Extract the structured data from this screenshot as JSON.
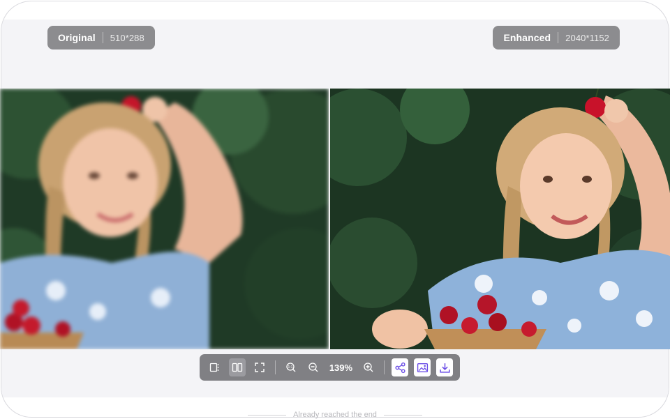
{
  "compare": {
    "original": {
      "label": "Original",
      "dimensions": "510*288"
    },
    "enhanced": {
      "label": "Enhanced",
      "dimensions": "2040*1152"
    }
  },
  "images": {
    "original_alt": "Original photo",
    "enhanced_alt": "Enhanced photo"
  },
  "toolbar": {
    "zoom_level": "139%"
  },
  "footer": {
    "text": "Already reached the end"
  },
  "colors": {
    "accent": "#6b4de6",
    "toolbar_bg": "#808084",
    "badge_bg": "#8c8c8f",
    "panel_bg": "#f4f4f7"
  }
}
